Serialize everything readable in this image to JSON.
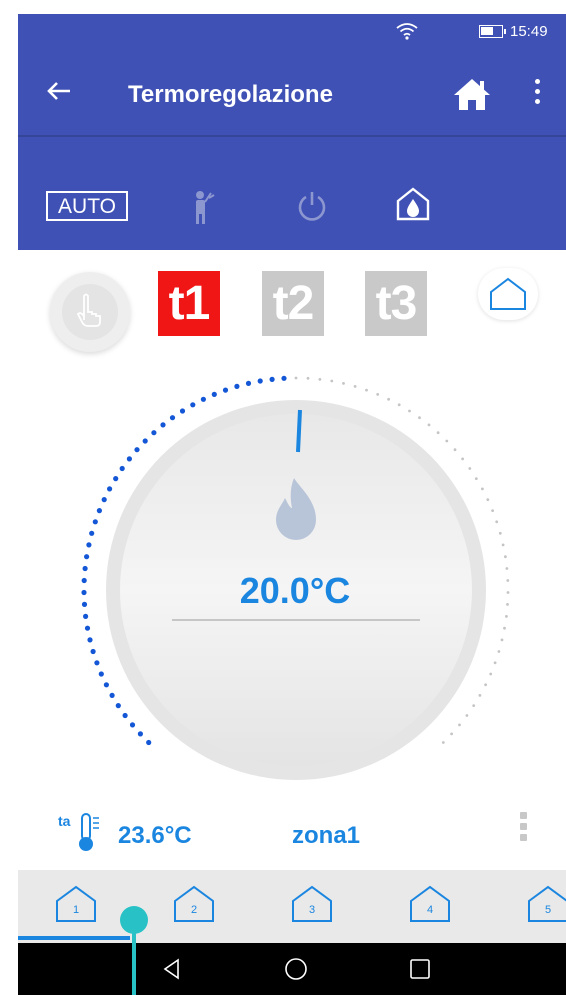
{
  "status_bar": {
    "time": "15:49",
    "icons": [
      "wifi-icon",
      "battery-icon"
    ]
  },
  "app_bar": {
    "title": "Termoregolazione",
    "icons": [
      "back-arrow-icon",
      "home-icon",
      "more-vert-icon"
    ]
  },
  "modes": {
    "auto_label": "AUTO",
    "icons": [
      "auto-mode",
      "holiday-person-icon",
      "power-icon",
      "antifreeze-house-icon"
    ]
  },
  "programs": {
    "manual_icon": "hand-manual-icon",
    "t1": "t1",
    "t2": "t2",
    "t3": "t3",
    "active": "t1",
    "zone_icon": "house-outline-icon"
  },
  "thermostat": {
    "setpoint": "20.0°C",
    "mode_icon": "flame-icon",
    "accent_color": "#1b86e0"
  },
  "zone_info": {
    "ambient_temp": "23.6°C",
    "ambient_icon": "ta-thermometer-icon",
    "zone_name": "zona1"
  },
  "zone_tabs": [
    {
      "label": "1",
      "selected": true
    },
    {
      "label": "2",
      "selected": false
    },
    {
      "label": "3",
      "selected": false
    },
    {
      "label": "4",
      "selected": false
    },
    {
      "label": "5",
      "selected": false
    }
  ],
  "colors": {
    "primary": "#3f51b5",
    "t1_active": "#f11616",
    "inactive": "#c9c9c9"
  }
}
